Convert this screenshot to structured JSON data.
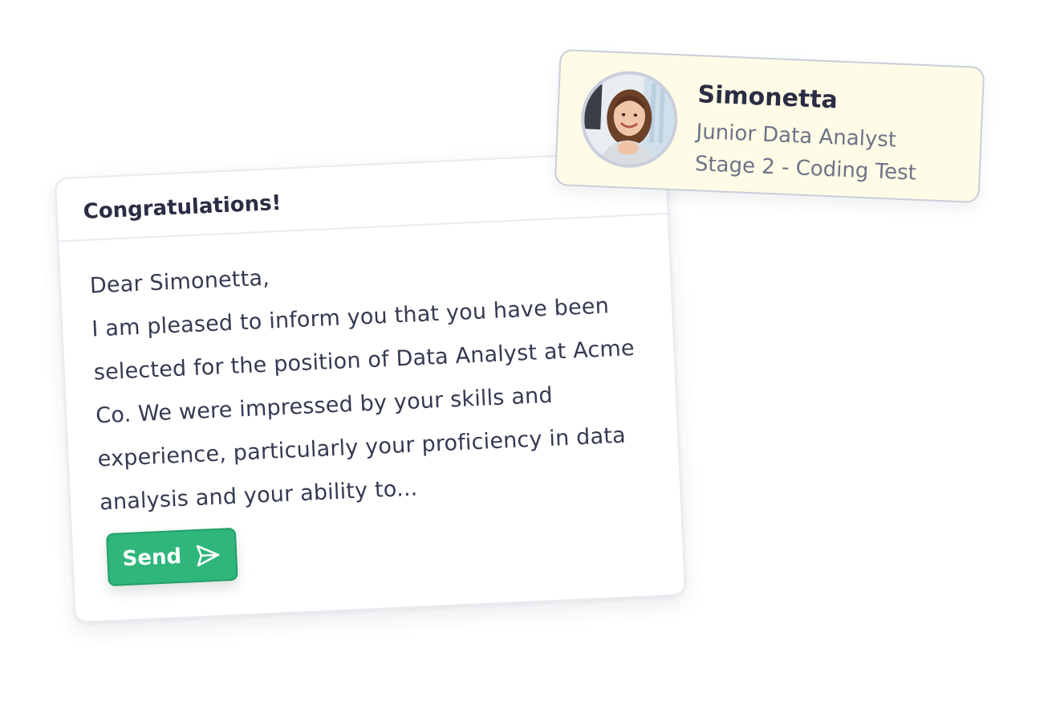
{
  "email": {
    "title": "Congratulations!",
    "greeting": "Dear Simonetta,",
    "body": "I am pleased to inform you that you have been selected for the position of Data Analyst at Acme Co. We were impressed by your skills and experience, particularly your proficiency in data analysis and your ability to...",
    "send_label": "Send",
    "send_icon": "send-icon"
  },
  "candidate": {
    "name": "Simonetta",
    "role": "Junior Data Analyst",
    "stage": "Stage 2 - Coding Test",
    "avatar_icon": "avatar"
  },
  "colors": {
    "send_button": "#2fb67a",
    "candidate_card_bg": "#fefbe6",
    "title_text": "#2a2d43",
    "muted_text": "#6e7388"
  }
}
